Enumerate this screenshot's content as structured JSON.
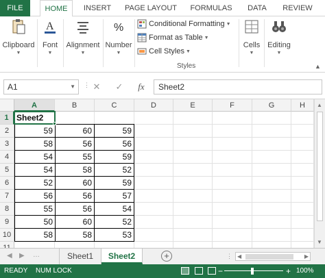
{
  "ribbon_tabs": [
    "FILE",
    "HOME",
    "INSERT",
    "PAGE LAYOUT",
    "FORMULAS",
    "DATA",
    "REVIEW"
  ],
  "ribbon": {
    "clipboard": "Clipboard",
    "font": "Font",
    "alignment": "Alignment",
    "number": "Number",
    "conditional_formatting": "Conditional Formatting",
    "format_as_table": "Format as Table",
    "cell_styles": "Cell Styles",
    "styles_group": "Styles",
    "cells": "Cells",
    "editing": "Editing"
  },
  "formula_bar": {
    "name_box": "A1",
    "fx": "fx",
    "content": "Sheet2"
  },
  "columns": [
    "A",
    "B",
    "C",
    "D",
    "E",
    "F",
    "G",
    "H"
  ],
  "rows": [
    "1",
    "2",
    "3",
    "4",
    "5",
    "6",
    "7",
    "8",
    "9",
    "10",
    "11"
  ],
  "header_cell": "Sheet2",
  "table": [
    [
      "59",
      "60",
      "59"
    ],
    [
      "58",
      "56",
      "56"
    ],
    [
      "54",
      "55",
      "59"
    ],
    [
      "54",
      "58",
      "52"
    ],
    [
      "52",
      "60",
      "59"
    ],
    [
      "56",
      "56",
      "57"
    ],
    [
      "55",
      "56",
      "54"
    ],
    [
      "50",
      "60",
      "52"
    ],
    [
      "58",
      "58",
      "53"
    ]
  ],
  "sheets": [
    "Sheet1",
    "Sheet2"
  ],
  "active_sheet": "Sheet2",
  "status": {
    "ready": "READY",
    "num_lock": "NUM LOCK",
    "zoom": "100%"
  },
  "colors": {
    "accent": "#217346"
  }
}
